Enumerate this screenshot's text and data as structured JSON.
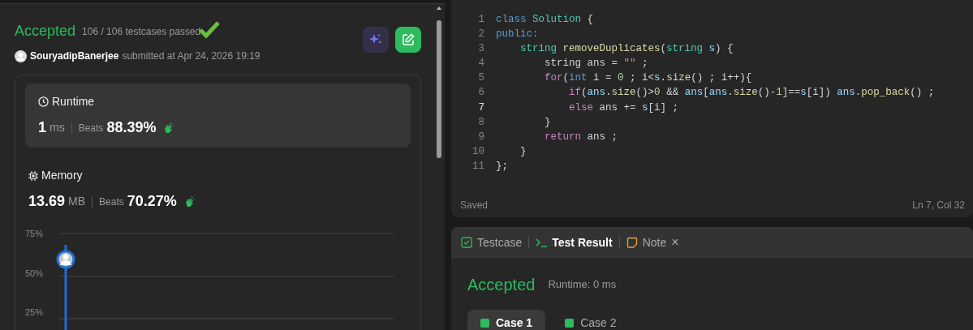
{
  "submission": {
    "status": "Accepted",
    "testcases": "106 / 106 testcases passed",
    "user": "SouryadipBanerjee",
    "submitted": "submitted at Apr 24, 2026 19:19"
  },
  "runtime": {
    "title": "Runtime",
    "value": "1",
    "unit": "ms",
    "beats_label": "Beats",
    "beats": "88.39%"
  },
  "memory": {
    "title": "Memory",
    "value": "13.69",
    "unit": "MB",
    "beats_label": "Beats",
    "beats": "70.27%"
  },
  "chart": {
    "y_labels": [
      "75%",
      "50%",
      "25%"
    ]
  },
  "editor": {
    "lines": [
      {
        "number": "1",
        "current": false,
        "tokens": [
          {
            "text": "class ",
            "kind": "kw"
          },
          {
            "text": "Solution",
            "kind": "type"
          },
          {
            "text": " {",
            "kind": "plain"
          }
        ]
      },
      {
        "number": "2",
        "current": false,
        "tokens": [
          {
            "text": "public:",
            "kind": "kw"
          }
        ]
      },
      {
        "number": "3",
        "current": false,
        "tokens": [
          {
            "text": "    string ",
            "kind": "type"
          },
          {
            "text": "removeDuplicates",
            "kind": "fn"
          },
          {
            "text": "(",
            "kind": "plain"
          },
          {
            "text": "string ",
            "kind": "type"
          },
          {
            "text": "s",
            "kind": "var"
          },
          {
            "text": ") {",
            "kind": "plain"
          }
        ]
      },
      {
        "number": "4",
        "current": false,
        "tokens": [
          {
            "text": "        string ans = ",
            "kind": "plain"
          },
          {
            "text": "\"\"",
            "kind": "str"
          },
          {
            "text": " ;",
            "kind": "plain"
          }
        ]
      },
      {
        "number": "5",
        "current": false,
        "tokens": [
          {
            "text": "        for",
            "kind": "ctrl"
          },
          {
            "text": "(",
            "kind": "plain"
          },
          {
            "text": "int",
            "kind": "kw"
          },
          {
            "text": " i = ",
            "kind": "plain"
          },
          {
            "text": "0",
            "kind": "num"
          },
          {
            "text": " ; i<",
            "kind": "plain"
          },
          {
            "text": "s",
            "kind": "var"
          },
          {
            "text": ".",
            "kind": "plain"
          },
          {
            "text": "size",
            "kind": "fn"
          },
          {
            "text": "() ; i++){",
            "kind": "plain"
          }
        ]
      },
      {
        "number": "6",
        "current": false,
        "tokens": [
          {
            "text": "            if",
            "kind": "ctrl"
          },
          {
            "text": "(",
            "kind": "plain"
          },
          {
            "text": "ans",
            "kind": "var"
          },
          {
            "text": ".",
            "kind": "plain"
          },
          {
            "text": "size",
            "kind": "fn"
          },
          {
            "text": "()>",
            "kind": "plain"
          },
          {
            "text": "0",
            "kind": "num"
          },
          {
            "text": " && ",
            "kind": "plain"
          },
          {
            "text": "ans",
            "kind": "var"
          },
          {
            "text": "[",
            "kind": "plain"
          },
          {
            "text": "ans",
            "kind": "var"
          },
          {
            "text": ".",
            "kind": "plain"
          },
          {
            "text": "size",
            "kind": "fn"
          },
          {
            "text": "()-",
            "kind": "plain"
          },
          {
            "text": "1",
            "kind": "num"
          },
          {
            "text": "]==",
            "kind": "plain"
          },
          {
            "text": "s",
            "kind": "var"
          },
          {
            "text": "[i]) ",
            "kind": "plain"
          },
          {
            "text": "ans",
            "kind": "var"
          },
          {
            "text": ".",
            "kind": "plain"
          },
          {
            "text": "pop_back",
            "kind": "fn"
          },
          {
            "text": "() ;",
            "kind": "plain"
          }
        ]
      },
      {
        "number": "7",
        "current": true,
        "tokens": [
          {
            "text": "            else",
            "kind": "ctrl"
          },
          {
            "text": " ans += ",
            "kind": "plain"
          },
          {
            "text": "s",
            "kind": "var"
          },
          {
            "text": "[i] ;",
            "kind": "plain"
          }
        ]
      },
      {
        "number": "8",
        "current": false,
        "tokens": [
          {
            "text": "        }",
            "kind": "plain"
          }
        ]
      },
      {
        "number": "9",
        "current": false,
        "tokens": [
          {
            "text": "        return",
            "kind": "ctrl"
          },
          {
            "text": " ans ;",
            "kind": "plain"
          }
        ]
      },
      {
        "number": "10",
        "current": false,
        "tokens": [
          {
            "text": "    }",
            "kind": "plain"
          }
        ]
      },
      {
        "number": "11",
        "current": false,
        "tokens": [
          {
            "text": "};",
            "kind": "plain"
          }
        ]
      }
    ],
    "status": "Saved",
    "position": "Ln 7, Col 32"
  },
  "tabs": [
    {
      "label": "Testcase",
      "selected": false,
      "kind": "testcase"
    },
    {
      "label": "Test Result",
      "selected": true,
      "kind": "result"
    },
    {
      "label": "Note",
      "selected": false,
      "kind": "note",
      "close": "×"
    }
  ],
  "result": {
    "status": "Accepted",
    "runtime": "Runtime: 0 ms"
  },
  "cases": [
    {
      "label": "Case 1",
      "selected": true
    },
    {
      "label": "Case 2",
      "selected": false
    }
  ]
}
